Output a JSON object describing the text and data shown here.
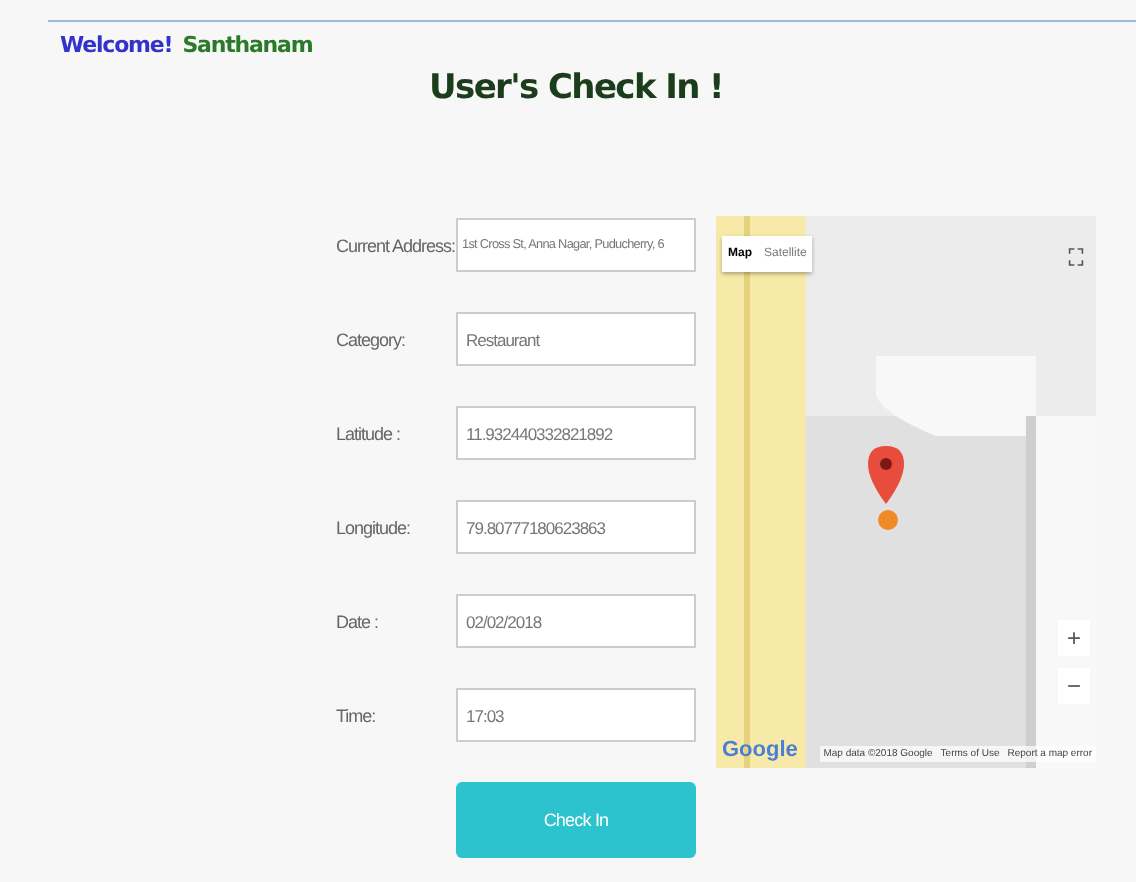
{
  "header": {
    "greeting": "Welcome!",
    "user": "Santhanam"
  },
  "title": "User's Check In !",
  "fields": [
    {
      "label": "Current Address:",
      "value": "1st Cross St, Anna Nagar, Puducherry, 6"
    },
    {
      "label": "Category:",
      "value": "Restaurant"
    },
    {
      "label": "Latitude :",
      "value": "11.932440332821892"
    },
    {
      "label": "Longitude:",
      "value": "79.80777180623863"
    },
    {
      "label": "Date :",
      "value": "02/02/2018"
    },
    {
      "label": "Time:",
      "value": "17:03"
    }
  ],
  "map": {
    "kind": "picture",
    "map_types": [
      {
        "label": "Map",
        "selected": true
      },
      {
        "label": "Satellite",
        "selected": false
      }
    ],
    "zoom_in": "+",
    "zoom_out": "−",
    "logo": "Google",
    "footer": [
      "Map data ©2018 Google",
      "Terms of Use",
      "Report a map error"
    ]
  },
  "submit": "Check In"
}
